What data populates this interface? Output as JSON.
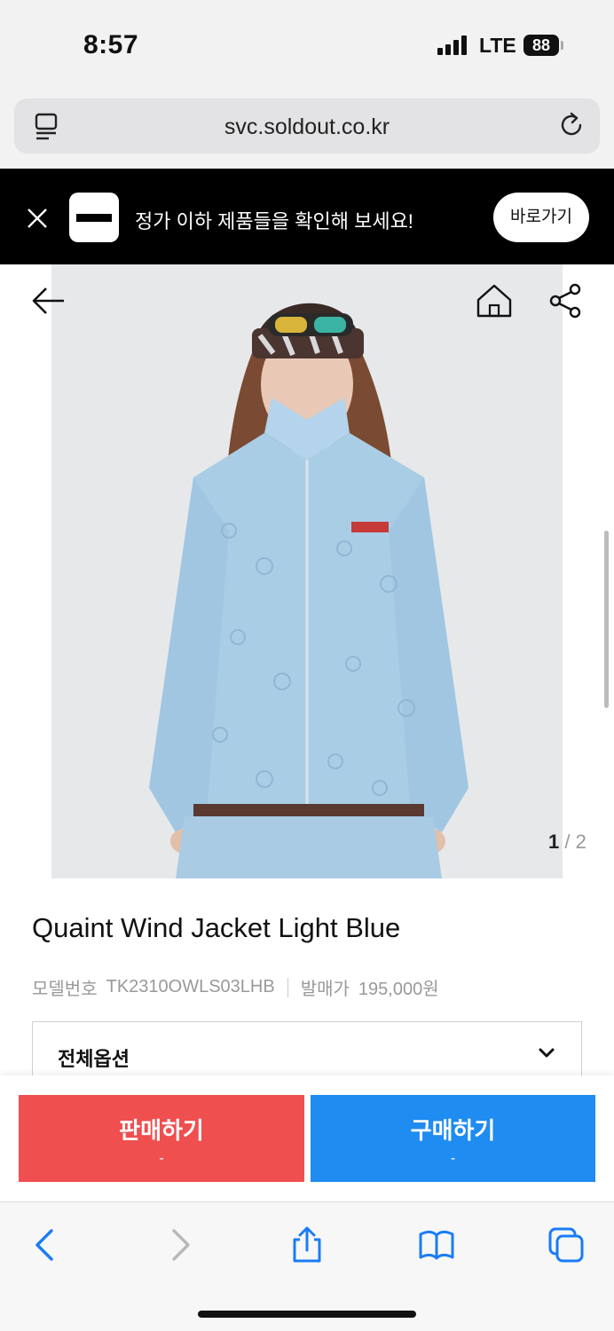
{
  "status_bar": {
    "time": "8:57",
    "network": "LTE",
    "battery": "88"
  },
  "browser": {
    "url": "svc.soldout.co.kr"
  },
  "promo_banner": {
    "text": "정가 이하 제품들을 확인해 보세요!",
    "button_label": "바로가기"
  },
  "gallery": {
    "current": "1",
    "separator": "/",
    "total": "2"
  },
  "product": {
    "name": "Quaint Wind Jacket Light Blue",
    "model_label": "모델번호",
    "model_number": "TK2310OWLS03LHB",
    "release_price_label": "발매가",
    "release_price": "195,000원"
  },
  "options": {
    "label": "전체옵션"
  },
  "actions": {
    "sell": {
      "label": "판매하기",
      "price": "-"
    },
    "buy": {
      "label": "구매하기",
      "price": "-"
    }
  },
  "colors": {
    "sell": "#ef4f4f",
    "buy": "#1e8cf0",
    "ios_blue": "#1a7cf5"
  },
  "icons": [
    "reader-icon",
    "reload-icon",
    "close-icon",
    "back-arrow-icon",
    "home-icon",
    "share-icon",
    "chevron-down-icon",
    "safari-back-icon",
    "safari-forward-icon",
    "safari-share-icon",
    "bookmarks-icon",
    "tabs-icon"
  ]
}
